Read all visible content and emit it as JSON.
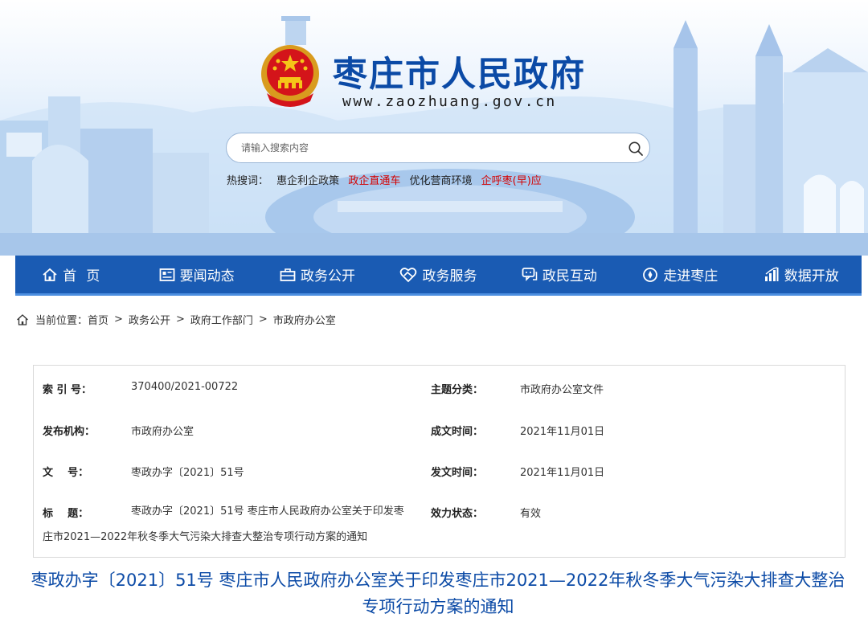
{
  "site": {
    "title": "枣庄市人民政府",
    "url": "www.zaozhuang.gov.cn"
  },
  "search": {
    "placeholder": "请输入搜索内容"
  },
  "hot_search": {
    "label": "热搜词：",
    "items": [
      {
        "text": "惠企利企政策",
        "color": "#222222"
      },
      {
        "text": "政企直通车",
        "color": "#d40000"
      },
      {
        "text": "优化营商环境",
        "color": "#222222"
      },
      {
        "text": "企呼枣(早)应",
        "color": "#d40000"
      }
    ]
  },
  "nav": {
    "items": [
      {
        "label": "首页",
        "icon": "home-icon"
      },
      {
        "label": "要闻动态",
        "icon": "news-icon"
      },
      {
        "label": "政务公开",
        "icon": "briefcase-icon"
      },
      {
        "label": "政务服务",
        "icon": "heart-hand-icon"
      },
      {
        "label": "政民互动",
        "icon": "chat-icon"
      },
      {
        "label": "走进枣庄",
        "icon": "compass-icon"
      },
      {
        "label": "数据开放",
        "icon": "bar-chart-icon"
      }
    ]
  },
  "breadcrumb": {
    "prefix": "当前位置：",
    "items": [
      "首页",
      "政务公开",
      "政府工作部门",
      "市政府办公室"
    ],
    "separator": ">"
  },
  "info": {
    "index_label": "索 引 号：",
    "index_value": "370400/2021-00722",
    "category_label": "主题分类：",
    "category_value": "市政府办公室文件",
    "issuer_label": "发布机构：",
    "issuer_value": "市政府办公室",
    "created_label": "成文时间：",
    "created_value": "2021年11月01日",
    "docnum_label": "文    号：",
    "docnum_value": "枣政办字〔2021〕51号",
    "published_label": "发文时间：",
    "published_value": "2021年11月01日",
    "title_label": "标    题：",
    "title_value": "枣政办字〔2021〕51号 枣庄市人民政府办公室关于印发枣庄市2021—2022年秋冬季大气污染大排查大整治专项行动方案的通知",
    "status_label": "效力状态：",
    "status_value": "有效"
  },
  "document": {
    "heading": "枣政办字〔2021〕51号 枣庄市人民政府办公室关于印发枣庄市2021—2022年秋冬季大气污染大排查大整治专项行动方案的通知"
  },
  "colors": {
    "brand_blue": "#0b4aa6",
    "nav_blue": "#1a5bb3",
    "hot_red": "#d40000"
  }
}
